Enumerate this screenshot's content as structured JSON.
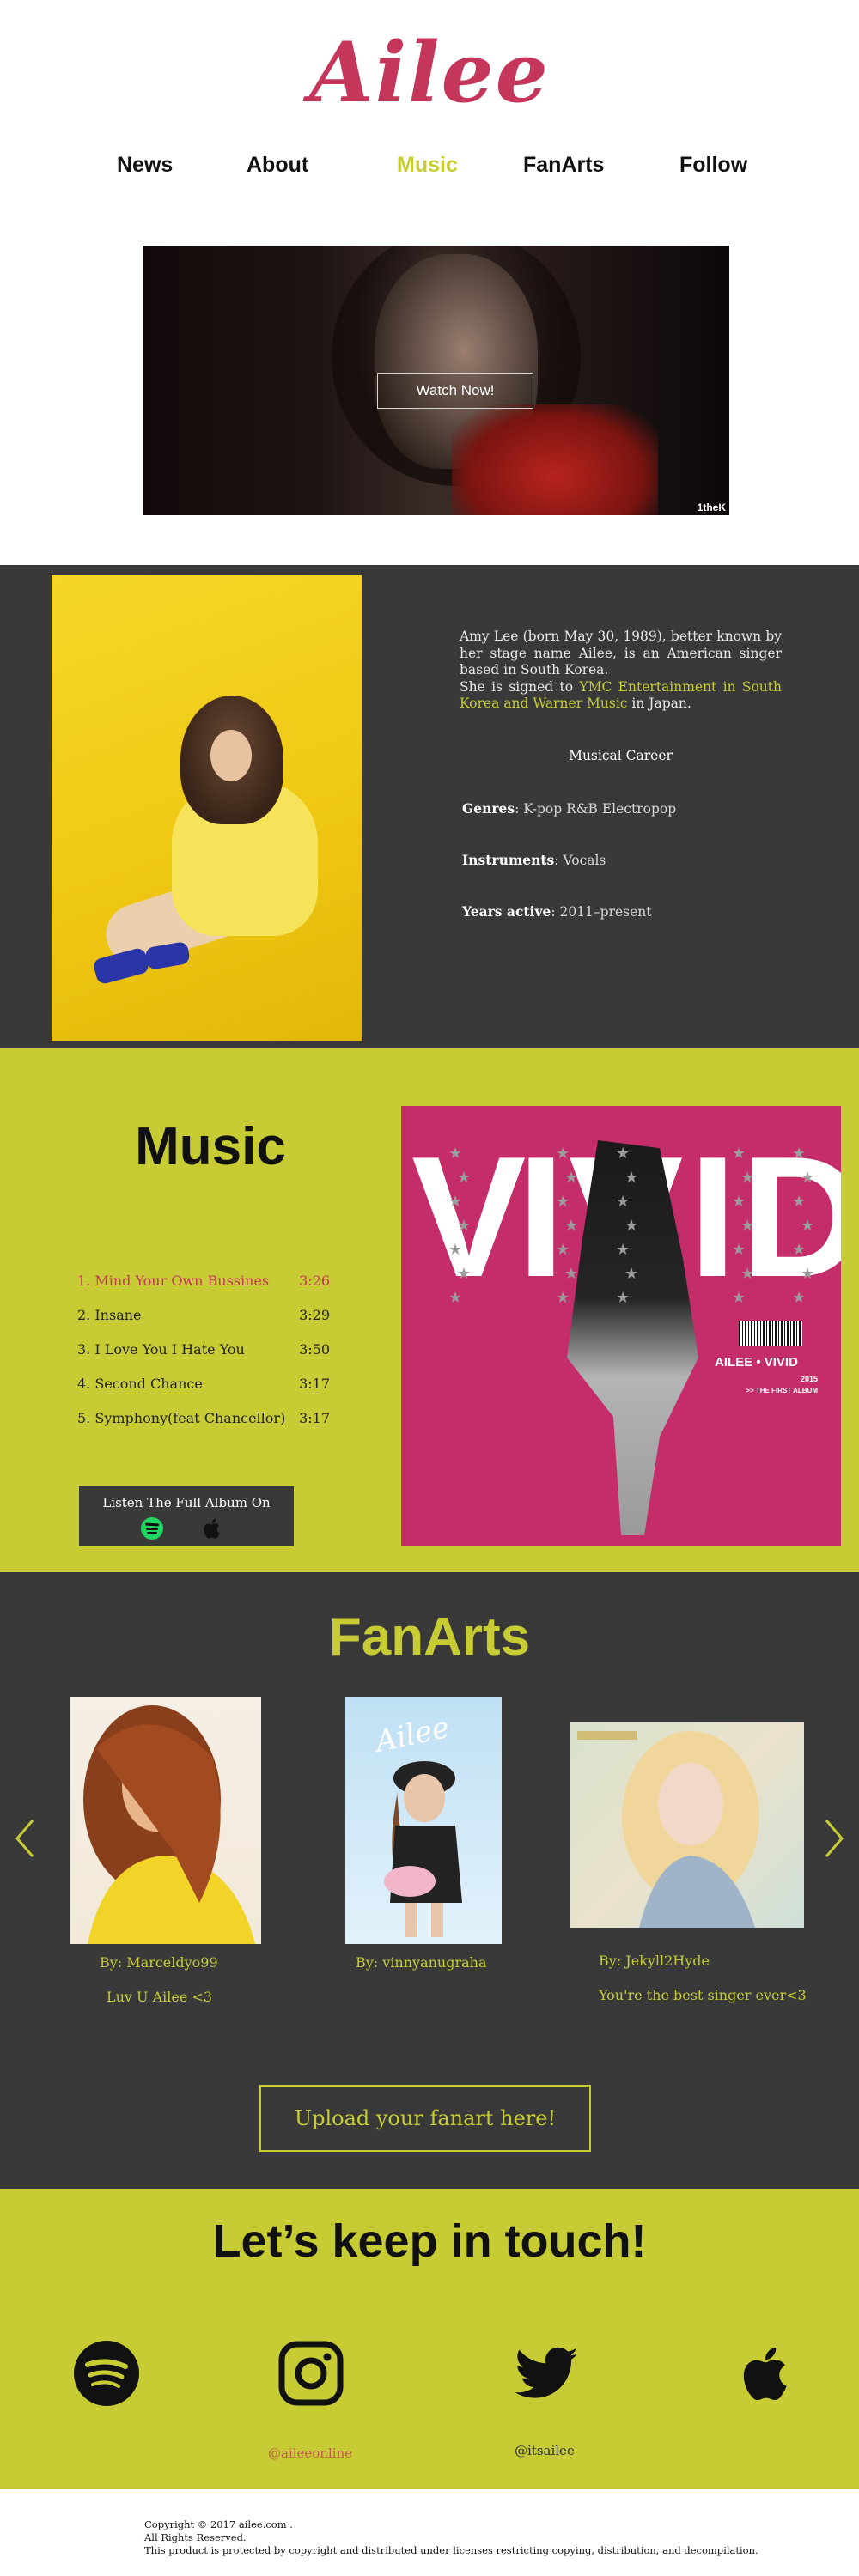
{
  "header": {
    "logo": "Ailee",
    "nav": [
      {
        "label": "News"
      },
      {
        "label": "About"
      },
      {
        "label": "Music",
        "active": true
      },
      {
        "label": "FanArts"
      },
      {
        "label": "Follow"
      }
    ]
  },
  "hero": {
    "watch_label": "Watch Now!",
    "brand": "1theK"
  },
  "about": {
    "bio_part1": "Amy Lee (born May 30, 1989), better known by her stage name Ailee, is an American singer based in South Korea.",
    "bio_part2": "She is signed to ",
    "bio_labels": "YMC Entertainment in South Korea and Warner Music",
    "bio_part3": " in Japan.",
    "career_title": "Musical Career",
    "facts": [
      {
        "label": "Genres",
        "sep": ": ",
        "value": "K-pop R&B Electropop"
      },
      {
        "label": "Instruments",
        "sep": ": ",
        "value": "Vocals"
      },
      {
        "label": "Years active",
        "sep": ":  ",
        "value": "2011–present"
      }
    ]
  },
  "music": {
    "title": "Music",
    "tracks": [
      {
        "name": "1. Mind Your Own Bussines",
        "duration": "3:26",
        "active": true
      },
      {
        "name": "2. Insane",
        "duration": "3:29"
      },
      {
        "name": "3. I Love You I Hate You",
        "duration": "3:50"
      },
      {
        "name": "4. Second Chance",
        "duration": "3:17"
      },
      {
        "name": "5. Symphony(feat Chancellor)",
        "duration": "3:17"
      }
    ],
    "listen_label": "Listen The Full Album On",
    "album": {
      "letters": "VIVID",
      "name": "AILEE • VIVID",
      "year": "2015",
      "subtitle": ">> THE FIRST ALBUM"
    },
    "colors": {
      "album_bg": "#c42d6a",
      "section_bg": "#c7cc34"
    }
  },
  "fanarts": {
    "title": "FanArts",
    "items": [
      {
        "author": "By: Marceldyo99",
        "message": "Luv U Ailee <3"
      },
      {
        "author": "By: vinnyanugraha",
        "message": ""
      },
      {
        "author": "By: Jekyll2Hyde",
        "message": "You're the best singer ever<3"
      }
    ],
    "fan2_text": "Ailee",
    "upload_label": "Upload your fanart here!"
  },
  "contact": {
    "title": "Let’s keep in touch!",
    "instagram_handle": "@aileeonline",
    "twitter_handle": "@itsailee",
    "icons": [
      "spotify-icon",
      "instagram-icon",
      "twitter-icon",
      "apple-icon"
    ]
  },
  "footer": {
    "line1": "Copyright ©  2017 ailee.com .",
    "line2": "All Rights Reserved.",
    "line3": "This product is protected by copyright and distributed under licenses restricting copying, distribution, and decompilation."
  },
  "theme": {
    "accent": "#c7cc34",
    "brand_pink": "#c4365a",
    "dark": "#393939"
  }
}
